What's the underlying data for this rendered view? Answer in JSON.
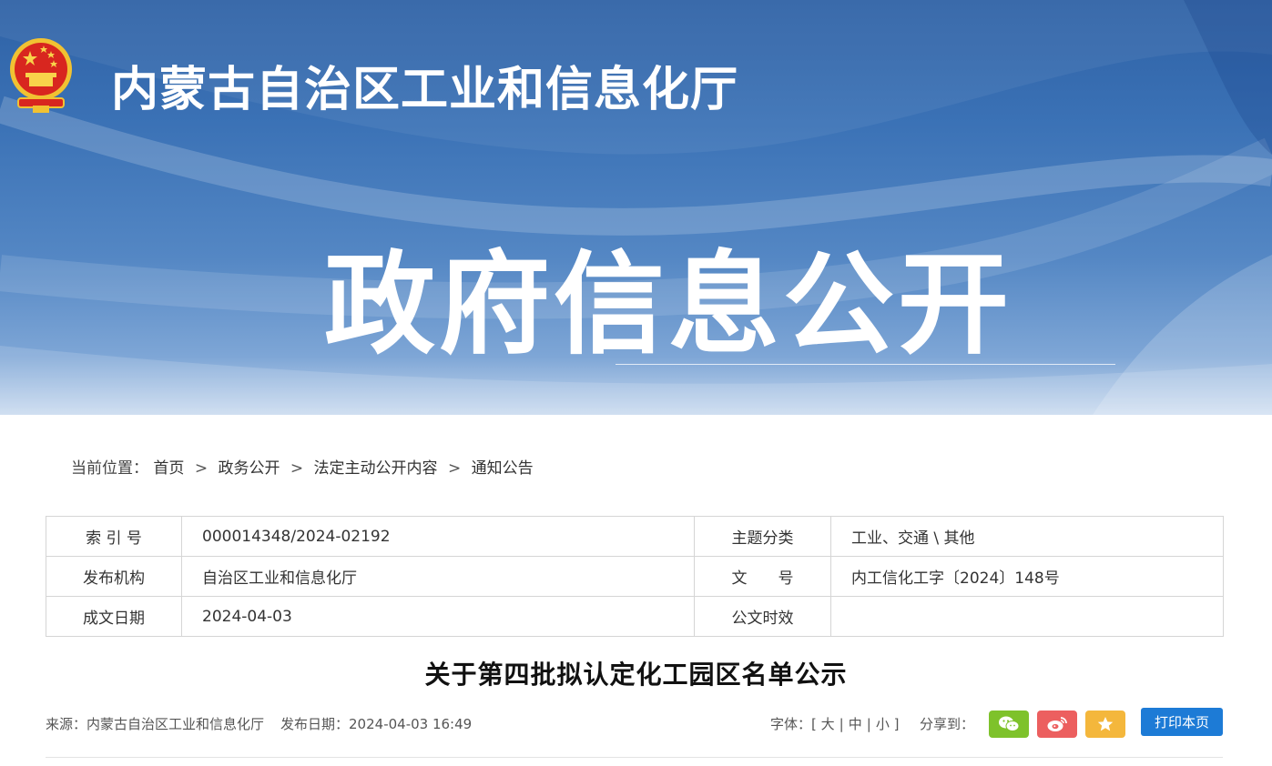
{
  "header": {
    "site_title": "内蒙古自治区工业和信息化厅",
    "section_title": "政府信息公开"
  },
  "breadcrumb": {
    "label": "当前位置：",
    "separator": ">",
    "items": [
      "首页",
      "政务公开",
      "法定主动公开内容",
      "通知公告"
    ]
  },
  "meta": {
    "rows": [
      {
        "k1": "索 引 号",
        "v1": "000014348/2024-02192",
        "k2": "主题分类",
        "v2": "工业、交通 \\ 其他"
      },
      {
        "k1": "发布机构",
        "v1": "自治区工业和信息化厅",
        "k2": "文　　号",
        "v2": "内工信化工字〔2024〕148号"
      },
      {
        "k1": "成文日期",
        "v1": "2024-04-03",
        "k2": "公文时效",
        "v2": ""
      }
    ]
  },
  "document": {
    "title": "关于第四批拟认定化工园区名单公示",
    "source": "来源：内蒙古自治区工业和信息化厅",
    "publish_date": "发布日期：2024-04-03 16:49"
  },
  "font_size": {
    "label": "字体：",
    "open": "[",
    "large": "大",
    "medium": "中",
    "small": "小",
    "close": "]"
  },
  "share": {
    "label": "分享到："
  },
  "print": {
    "label": "打印本页"
  },
  "colors": {
    "banner_blue": "#2e61a5",
    "print_button": "#1d7bd6",
    "wechat": "#7ec22b",
    "weibo": "#ec5f5f",
    "favorite": "#f4b73c"
  },
  "icons": [
    "national-emblem-icon",
    "wechat-icon",
    "weibo-icon",
    "star-icon"
  ]
}
